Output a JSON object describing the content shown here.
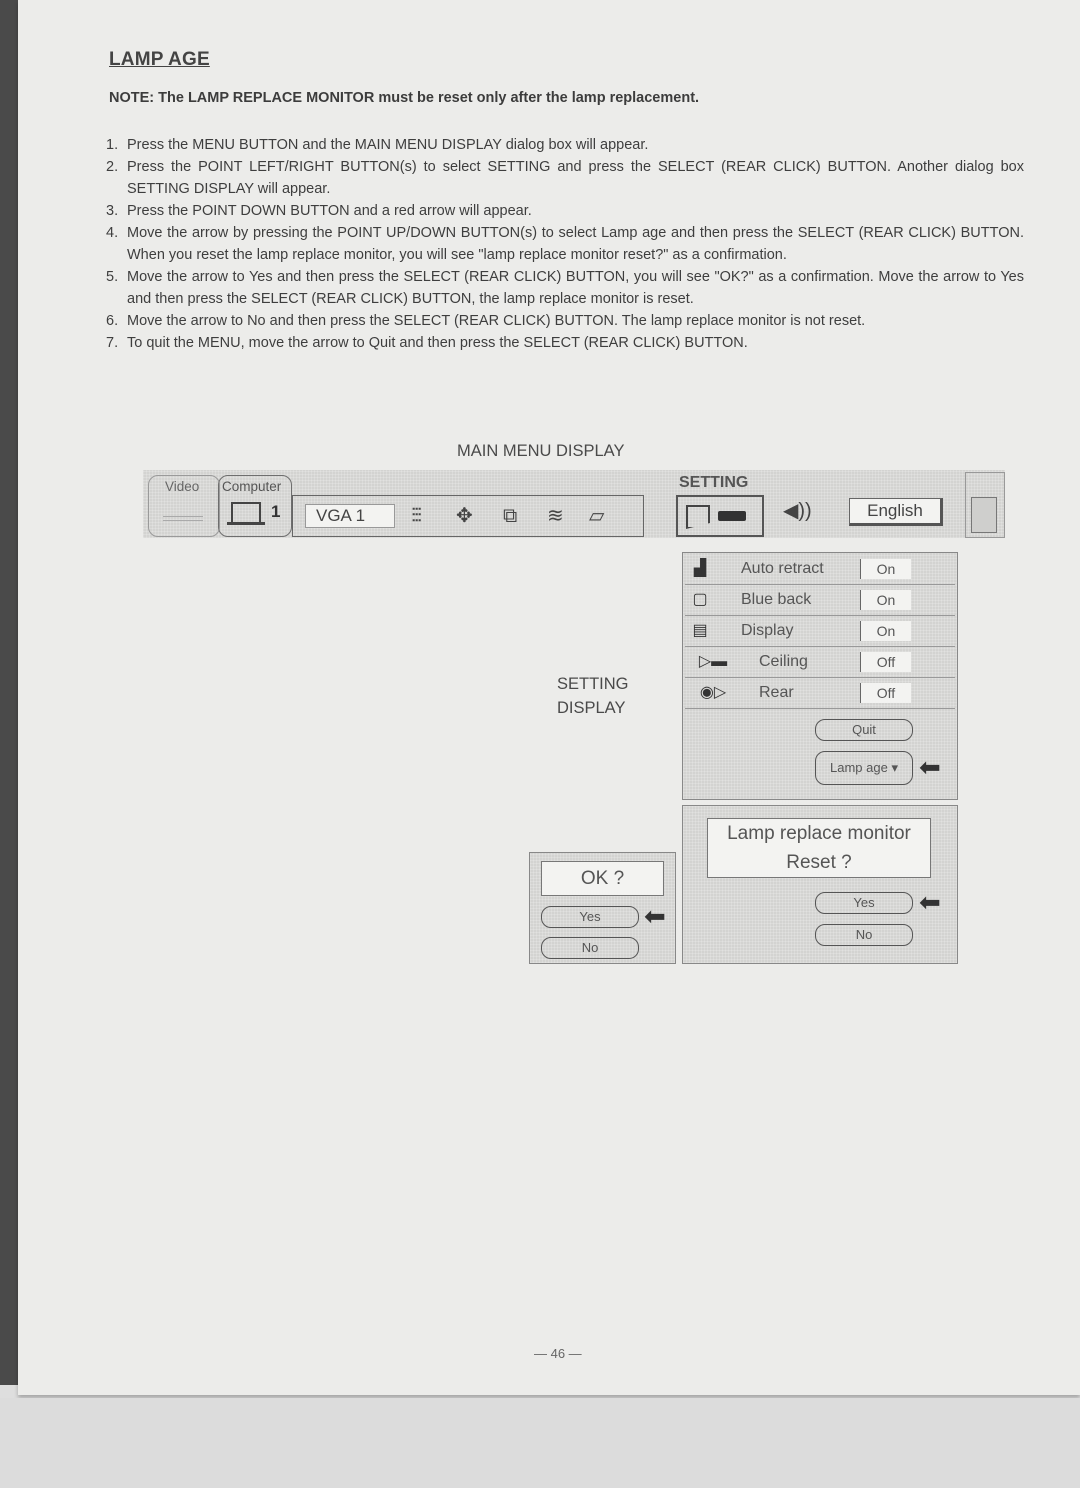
{
  "document": {
    "title": "LAMP AGE",
    "note": "NOTE: The LAMP REPLACE MONITOR must be reset only after the lamp replacement.",
    "steps": [
      {
        "num": "1.",
        "text": "Press the MENU BUTTON and the MAIN MENU DISPLAY dialog box will appear."
      },
      {
        "num": "2.",
        "text": "Press the POINT LEFT/RIGHT BUTTON(s) to select SETTING and press the SELECT (REAR CLICK) BUTTON. Another dialog box SETTING DISPLAY will appear."
      },
      {
        "num": "3.",
        "text": "Press the POINT DOWN BUTTON and a red arrow will appear."
      },
      {
        "num": "4.",
        "text": "Move the arrow by pressing the POINT UP/DOWN BUTTON(s) to select Lamp age and then press the SELECT (REAR CLICK) BUTTON. When you reset the lamp replace monitor, you will see \"lamp replace monitor reset?\" as a confirmation."
      },
      {
        "num": "5.",
        "text": "Move the arrow to Yes and then press the SELECT (REAR CLICK) BUTTON, you will see \"OK?\" as a confirmation. Move the arrow to Yes and then press the SELECT (REAR CLICK) BUTTON, the lamp replace monitor is reset."
      },
      {
        "num": "6.",
        "text": "Move the arrow to No and then press the SELECT (REAR CLICK) BUTTON. The lamp replace monitor is not reset."
      },
      {
        "num": "7.",
        "text": "To quit the MENU, move the arrow to Quit and then press the SELECT (REAR CLICK) BUTTON."
      }
    ],
    "page_number": "— 46 —"
  },
  "figure": {
    "main_menu_caption": "MAIN MENU DISPLAY",
    "setting_display_caption_1": "SETTING",
    "setting_display_caption_2": "DISPLAY",
    "menubar": {
      "tab_video": "Video",
      "tab_computer": "Computer",
      "computer_number": "1",
      "source_value": "VGA 1",
      "icons": [
        "image-adjust-icon",
        "position-icon",
        "pc-adjust-icon",
        "noise-icon",
        "screen-icon"
      ],
      "setting_label": "SETTING",
      "language_value": "English"
    },
    "setting_panel": {
      "rows": [
        {
          "icon": "auto-retract-icon",
          "label": "Auto retract",
          "value": "On"
        },
        {
          "icon": "blue-back-icon",
          "label": "Blue back",
          "value": "On"
        },
        {
          "icon": "display-icon",
          "label": "Display",
          "value": "On"
        },
        {
          "icon": "ceiling-icon",
          "label": "Ceiling",
          "value": "Off"
        },
        {
          "icon": "rear-icon",
          "label": "Rear",
          "value": "Off"
        }
      ],
      "quit_label": "Quit",
      "lamp_age_label": "Lamp age ▾"
    },
    "reset_dialog": {
      "line1": "Lamp replace monitor",
      "line2": "Reset ?",
      "yes": "Yes",
      "no": "No"
    },
    "ok_dialog": {
      "message": "OK ?",
      "yes": "Yes",
      "no": "No"
    }
  }
}
